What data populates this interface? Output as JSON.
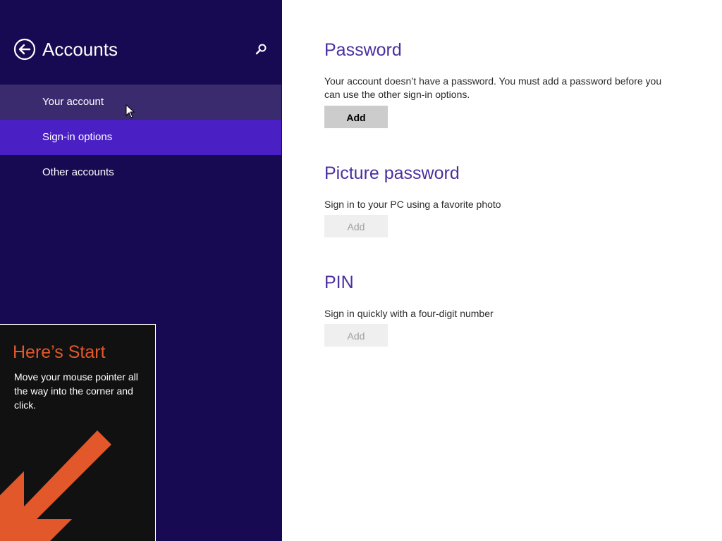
{
  "header": {
    "title": "Accounts",
    "back_icon": "back-arrow-icon",
    "search_icon": "search-icon"
  },
  "nav": {
    "items": [
      {
        "label": "Your account",
        "state": "hover"
      },
      {
        "label": "Sign-in options",
        "state": "selected"
      },
      {
        "label": "Other accounts",
        "state": "normal"
      }
    ]
  },
  "tip": {
    "title": "Here’s Start",
    "body": "Move your mouse pointer all the way into the corner and click.",
    "arrow_icon": "arrow-down-left-icon"
  },
  "sections": {
    "password": {
      "title": "Password",
      "description": "Your account doesn’t have a password. You must add a password before you can use the other sign-in options.",
      "button_label": "Add",
      "button_enabled": true
    },
    "picture_password": {
      "title": "Picture password",
      "description": "Sign in to your PC using a favorite photo",
      "button_label": "Add",
      "button_enabled": false
    },
    "pin": {
      "title": "PIN",
      "description": "Sign in quickly with a four-digit number",
      "button_label": "Add",
      "button_enabled": false
    }
  },
  "colors": {
    "sidebar_bg": "#180a52",
    "selected_bg": "#4a1fc4",
    "hover_bg": "#3a2a6e",
    "heading_accent": "#4b2fa0",
    "tip_accent": "#e2582b"
  }
}
